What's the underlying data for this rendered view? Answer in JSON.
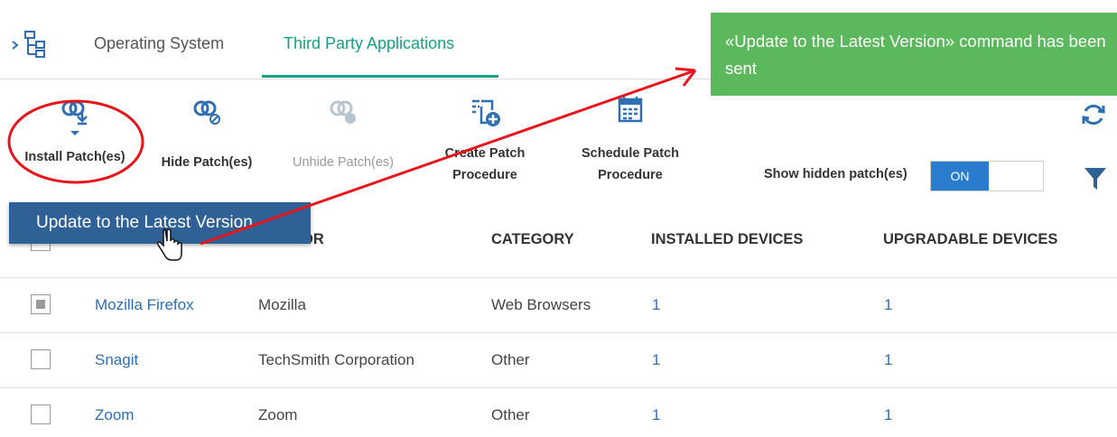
{
  "tabs": {
    "os_label": "Operating System",
    "tpa_label": "Third Party Applications"
  },
  "toolbar": {
    "install_label": "Install Patch(es)",
    "hide_label": "Hide Patch(es)",
    "unhide_label": "Unhide Patch(es)",
    "create_line1": "Create Patch",
    "create_line2": "Procedure",
    "schedule_line1": "Schedule Patch",
    "schedule_line2": "Procedure",
    "show_hidden_label": "Show hidden patch(es)",
    "toggle_state": "ON"
  },
  "dropdown": {
    "item": "Update to the Latest Version"
  },
  "table": {
    "headers": {
      "vendor": "OR",
      "category": "CATEGORY",
      "installed": "INSTALLED DEVICES",
      "upgradable": "UPGRADABLE DEVICES"
    },
    "rows": [
      {
        "name": "Mozilla Firefox",
        "vendor": "Mozilla",
        "category": "Web Browsers",
        "installed": "1",
        "upgradable": "1"
      },
      {
        "name": "Snagit",
        "vendor": "TechSmith Corporation",
        "category": "Other",
        "installed": "1",
        "upgradable": "1"
      },
      {
        "name": "Zoom",
        "vendor": "Zoom",
        "category": "Other",
        "installed": "1",
        "upgradable": "1"
      }
    ]
  },
  "toast": {
    "message": "«Update to the Latest Version» command has been sent"
  },
  "colors": {
    "accent": "#16a085",
    "primary": "#2f6196",
    "toast_bg": "#5cb85c",
    "annotation": "#e8141b"
  }
}
